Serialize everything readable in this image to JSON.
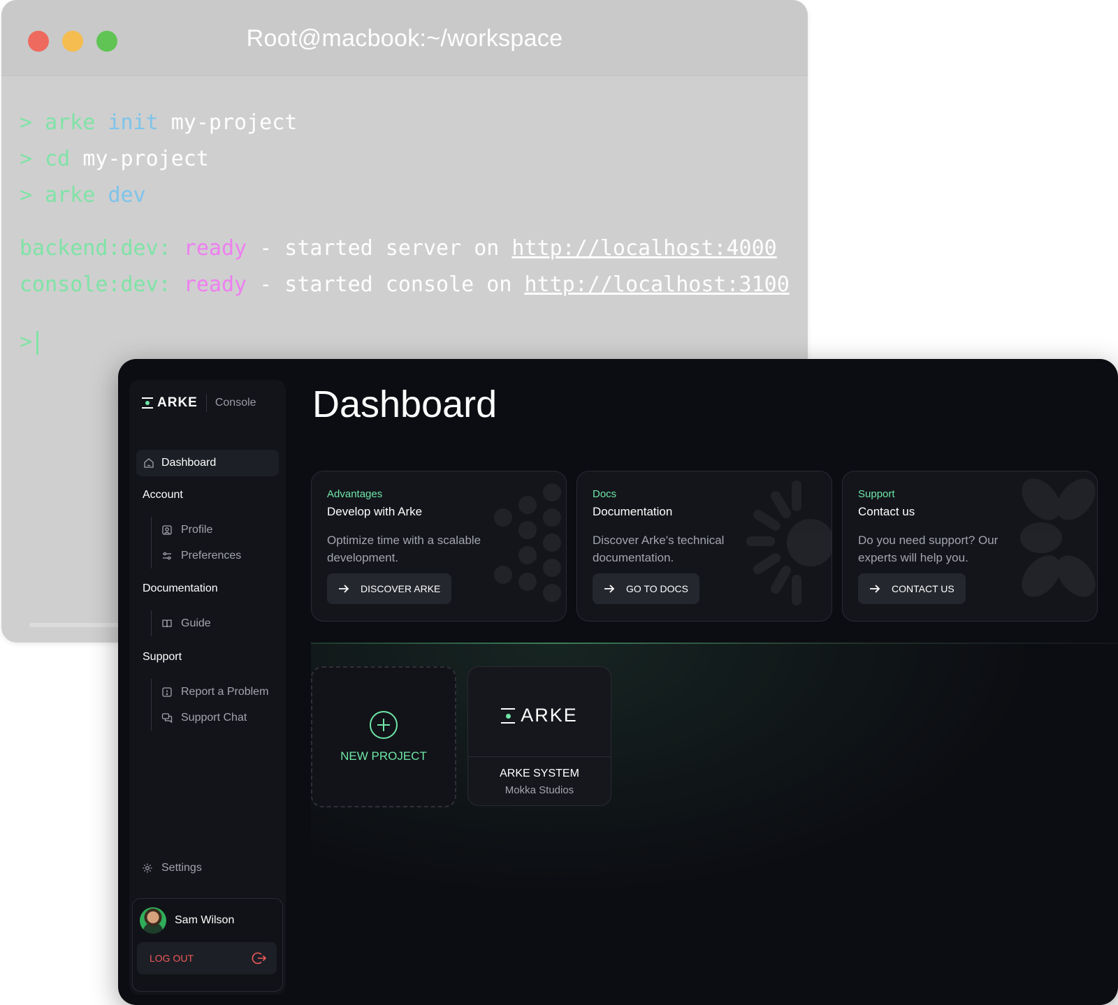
{
  "terminal": {
    "title": "Root@macbook:~/workspace",
    "prompt": ">",
    "commands": [
      {
        "cmd": "arke",
        "arg": "init",
        "rest": "my-project"
      },
      {
        "cmd": "cd",
        "arg": "",
        "rest": "my-project"
      },
      {
        "cmd": "arke",
        "arg": "dev",
        "rest": ""
      }
    ],
    "logs": [
      {
        "source": "backend:dev:",
        "status": "ready",
        "message": "- started server on",
        "url": "http://localhost:4000"
      },
      {
        "source": "console:dev:",
        "status": "ready",
        "message": "- started console on",
        "url": "http://localhost:3100"
      }
    ]
  },
  "sidebar": {
    "brand": "ARKE",
    "brand_sub": "Console",
    "dashboard_label": "Dashboard",
    "sections": [
      {
        "title": "Account",
        "items": [
          {
            "label": "Profile",
            "icon": "profile-icon"
          },
          {
            "label": "Preferences",
            "icon": "sliders-icon"
          }
        ]
      },
      {
        "title": "Documentation",
        "items": [
          {
            "label": "Guide",
            "icon": "book-icon"
          }
        ]
      },
      {
        "title": "Support",
        "items": [
          {
            "label": "Report a Problem",
            "icon": "alert-icon"
          },
          {
            "label": "Support Chat",
            "icon": "chat-icon"
          }
        ]
      }
    ],
    "settings_label": "Settings",
    "user_name": "Sam Wilson",
    "logout_label": "LOG OUT"
  },
  "main": {
    "title": "Dashboard",
    "cards": [
      {
        "eyebrow": "Advantages",
        "title": "Develop with Arke",
        "description": "Optimize time with a scalable development.",
        "button": "DISCOVER ARKE"
      },
      {
        "eyebrow": "Docs",
        "title": "Documentation",
        "description": "Discover Arke's technical documentation.",
        "button": "GO TO DOCS"
      },
      {
        "eyebrow": "Support",
        "title": "Contact us",
        "description": "Do you need support? Our experts will help you.",
        "button": "CONTACT US"
      }
    ],
    "new_project_label": "NEW PROJECT",
    "project": {
      "logo": "ARKE",
      "name": "ARKE SYSTEM",
      "org": "Mokka Studios"
    }
  },
  "colors": {
    "accent": "#6ee7a8",
    "danger": "#f05a5a",
    "background": "#0c0d12",
    "terminal": "#cfcfcf"
  }
}
